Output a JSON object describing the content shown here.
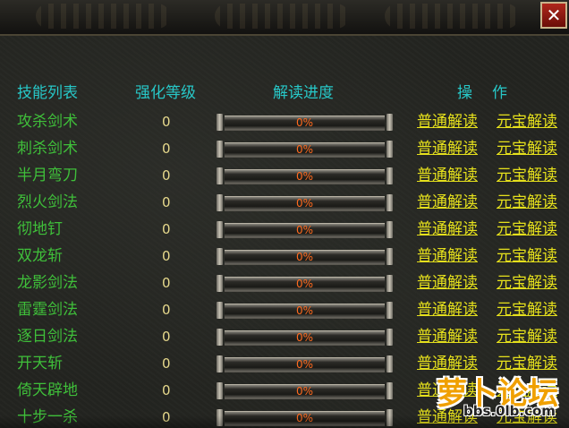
{
  "window": {
    "close_label": "✕"
  },
  "headers": {
    "skill": "技能列表",
    "level": "强化等级",
    "progress": "解读进度",
    "operation": "操作"
  },
  "rows": [
    {
      "name": "攻杀剑术",
      "level": "0",
      "progress": "0%",
      "progress_value": 0,
      "normal": "普通解读",
      "gold": "元宝解读"
    },
    {
      "name": "刺杀剑术",
      "level": "0",
      "progress": "0%",
      "progress_value": 0,
      "normal": "普通解读",
      "gold": "元宝解读"
    },
    {
      "name": "半月弯刀",
      "level": "0",
      "progress": "0%",
      "progress_value": 0,
      "normal": "普通解读",
      "gold": "元宝解读"
    },
    {
      "name": "烈火剑法",
      "level": "0",
      "progress": "0%",
      "progress_value": 0,
      "normal": "普通解读",
      "gold": "元宝解读"
    },
    {
      "name": "彻地钉",
      "level": "0",
      "progress": "0%",
      "progress_value": 0,
      "normal": "普通解读",
      "gold": "元宝解读"
    },
    {
      "name": "双龙斩",
      "level": "0",
      "progress": "0%",
      "progress_value": 0,
      "normal": "普通解读",
      "gold": "元宝解读"
    },
    {
      "name": "龙影剑法",
      "level": "0",
      "progress": "0%",
      "progress_value": 0,
      "normal": "普通解读",
      "gold": "元宝解读"
    },
    {
      "name": "雷霆剑法",
      "level": "0",
      "progress": "0%",
      "progress_value": 0,
      "normal": "普通解读",
      "gold": "元宝解读"
    },
    {
      "name": "逐日剑法",
      "level": "0",
      "progress": "0%",
      "progress_value": 0,
      "normal": "普通解读",
      "gold": "元宝解读"
    },
    {
      "name": "开天斩",
      "level": "0",
      "progress": "0%",
      "progress_value": 0,
      "normal": "普通解读",
      "gold": "元宝解读"
    },
    {
      "name": "倚天辟地",
      "level": "0",
      "progress": "0%",
      "progress_value": 0,
      "normal": "普通解读",
      "gold": "元宝解读"
    },
    {
      "name": "十步一杀",
      "level": "0",
      "progress": "0%",
      "progress_value": 0,
      "normal": "普通解读",
      "gold": "元宝解读"
    }
  ],
  "watermark": {
    "logo": "萝卜论坛",
    "url": "bbs.0lb.com"
  },
  "colors": {
    "header": "#27c8c8",
    "skill_name": "#3fbf3a",
    "level": "#e7d98c",
    "progress_text": "#ff6a1e",
    "link": "#e5e01c",
    "close_bg": "#b0281c"
  }
}
